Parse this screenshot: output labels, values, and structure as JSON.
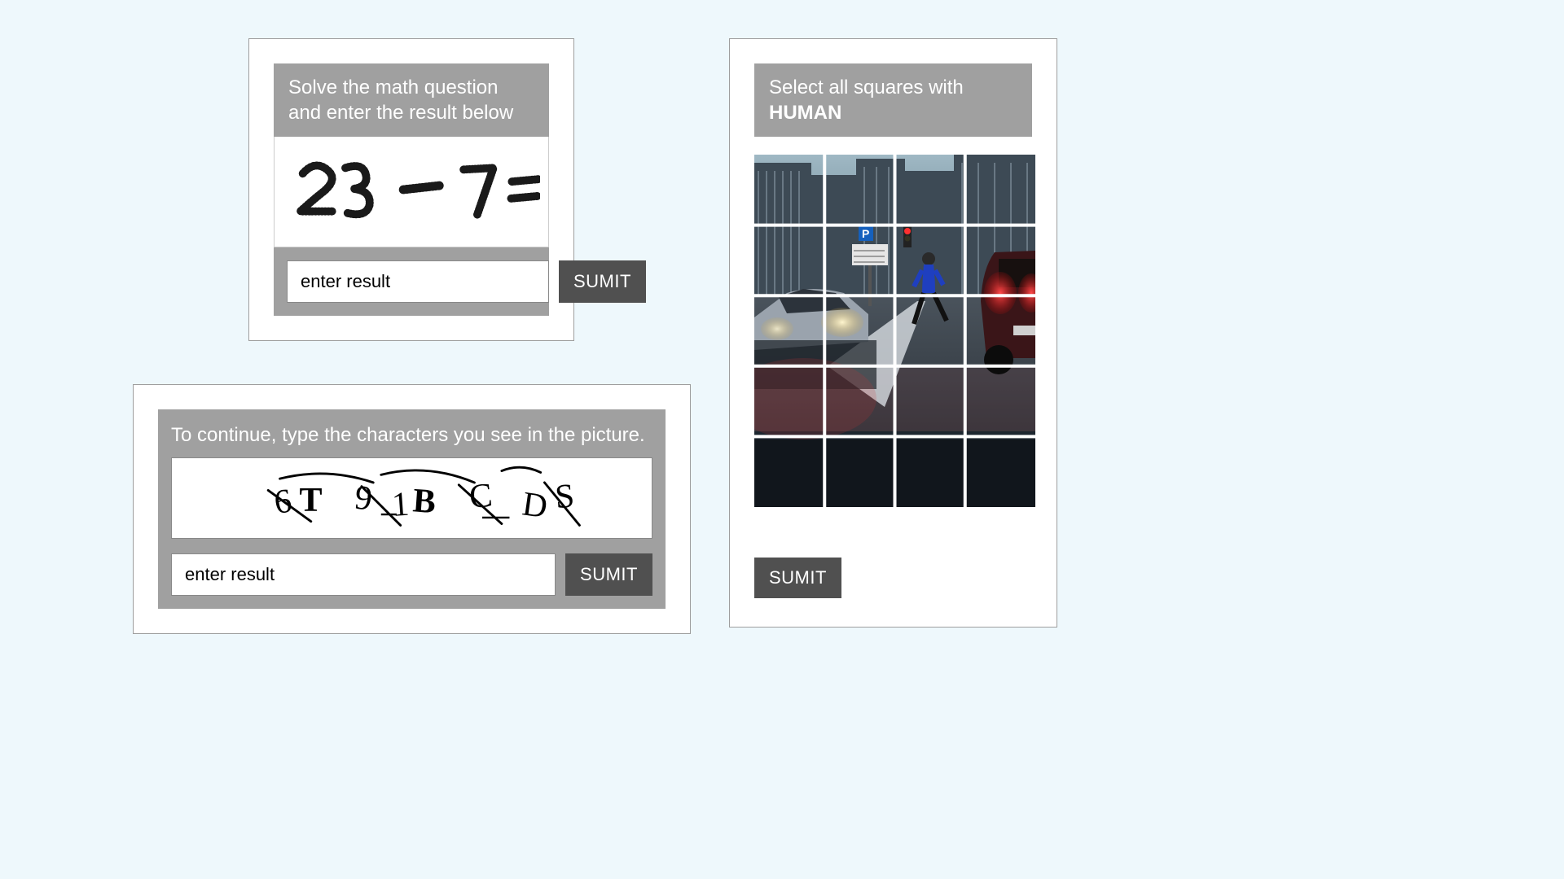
{
  "math": {
    "instruction_l1": "Solve the math question",
    "instruction_l2": "and enter the result below",
    "expression": "23 - 7 =",
    "input_placeholder": "enter result",
    "submit_label": "SUMIT"
  },
  "text": {
    "instruction": "To continue, type the characters you see in the picture.",
    "chars": "6T 9 B C D S",
    "input_placeholder": "enter result",
    "submit_label": "SUMIT"
  },
  "image": {
    "instruction_l1": "Select all squares with",
    "instruction_l2": "HUMAN",
    "submit_label": "SUMIT",
    "grid": {
      "rows": 5,
      "cols": 4
    }
  }
}
